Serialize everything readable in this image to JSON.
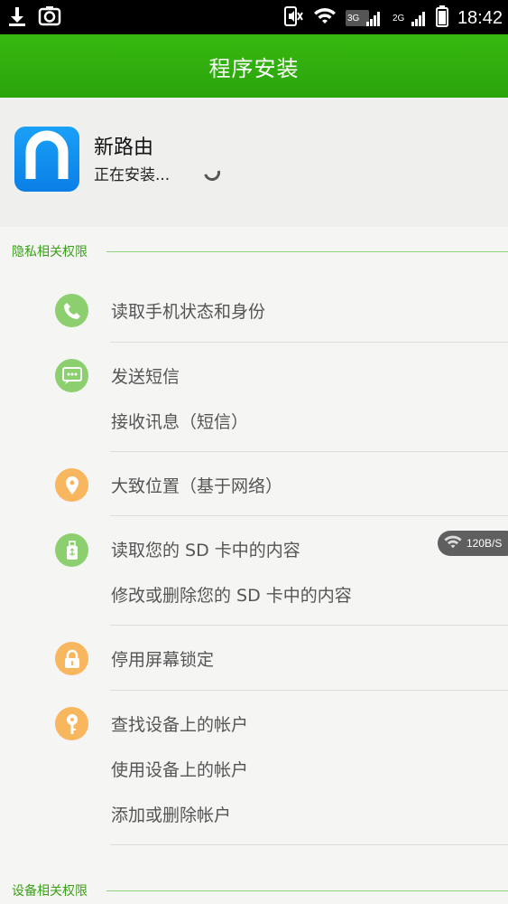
{
  "status_bar": {
    "time": "18:42",
    "network_3g_label": "3G",
    "network_2g_label": "2G",
    "icons": [
      "download-icon",
      "screenshot-icon",
      "mute-vibrate-icon",
      "wifi-icon",
      "signal-3g-icon",
      "signal-2g-icon",
      "battery-icon"
    ]
  },
  "header": {
    "title": "程序安装"
  },
  "app": {
    "name": "新路由",
    "status": "正在安装..."
  },
  "sections": [
    {
      "title": "隐私相关权限"
    },
    {
      "title": "设备相关权限"
    }
  ],
  "permissions": [
    {
      "icon": "phone-icon",
      "color": "#8ccf6e",
      "items": [
        "读取手机状态和身份"
      ]
    },
    {
      "icon": "message-icon",
      "color": "#8ccf6e",
      "items": [
        "发送短信",
        "接收讯息（短信）"
      ]
    },
    {
      "icon": "location-icon",
      "color": "#f8b75f",
      "items": [
        "大致位置（基于网络）"
      ]
    },
    {
      "icon": "usb-storage-icon",
      "color": "#8ccf6e",
      "items": [
        "读取您的 SD 卡中的内容",
        "修改或删除您的 SD 卡中的内容"
      ]
    },
    {
      "icon": "lock-icon",
      "color": "#f8b75f",
      "items": [
        "停用屏幕锁定"
      ]
    },
    {
      "icon": "key-icon",
      "color": "#f8b75f",
      "items": [
        "查找设备上的帐户",
        "使用设备上的帐户",
        "添加或删除帐户"
      ]
    }
  ],
  "speed_badge": {
    "text": "120B/S",
    "icon": "wifi-icon"
  }
}
